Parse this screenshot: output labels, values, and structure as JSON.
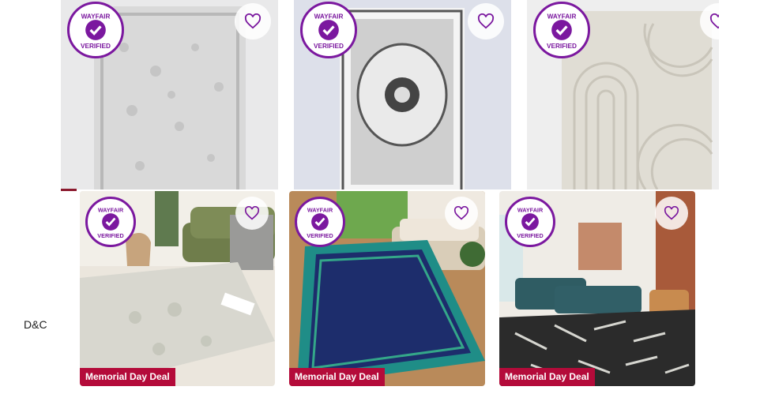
{
  "top_row": [
    {
      "id": "rug-1",
      "alt": "grey distressed overdyed rug",
      "badge_top": "WAYFAIR",
      "badge_bottom": "VERIFIED"
    },
    {
      "id": "rug-2",
      "alt": "grey medallion rug",
      "badge_top": "WAYFAIR",
      "badge_bottom": "VERIFIED"
    },
    {
      "id": "rug-3",
      "alt": "cream arch pattern rug",
      "badge_top": "WAYFAIR",
      "badge_bottom": "VERIFIED"
    }
  ],
  "bottom_row": [
    {
      "id": "rug-4",
      "deal": "Memorial Day Deal",
      "badge_top": "WAYFAIR",
      "badge_bottom": "VERIFIED"
    },
    {
      "id": "rug-5",
      "deal": "Memorial Day Deal",
      "badge_top": "WAYFAIR",
      "badge_bottom": "VERIFIED"
    },
    {
      "id": "rug-6",
      "deal": "Memorial Day Deal",
      "badge_top": "WAYFAIR",
      "badge_bottom": "VERIFIED"
    }
  ],
  "side_label": "D&C",
  "colors": {
    "brand_purple": "#7b189f",
    "deal_red": "#b40b3a",
    "heart_stroke": "#7b189f"
  }
}
